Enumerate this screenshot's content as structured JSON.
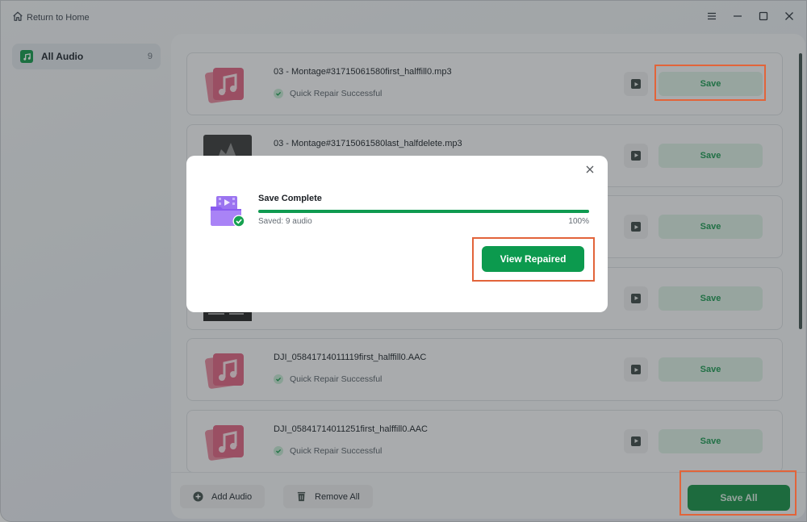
{
  "titlebar": {
    "return_label": "Return to Home",
    "controls": [
      "menu-icon",
      "minimize-icon",
      "maximize-icon",
      "close-icon"
    ]
  },
  "sidebar": {
    "items": [
      {
        "label": "All Audio",
        "count": "9",
        "icon": "music-note-icon"
      }
    ]
  },
  "files": [
    {
      "name": "03 - Montage#31715061580first_halffill0.mp3",
      "status": "Quick Repair Successful",
      "thumb": "audio",
      "save_label": "Save"
    },
    {
      "name": "03 - Montage#31715061580last_halfdelete.mp3",
      "status": "",
      "thumb": "photo",
      "save_label": "Save"
    },
    {
      "name": "",
      "status": "",
      "thumb": "photo",
      "save_label": "Save"
    },
    {
      "name": "",
      "status": "",
      "thumb": "photo",
      "save_label": "Save"
    },
    {
      "name": "DJI_05841714011119first_halffill0.AAC",
      "status": "Quick Repair Successful",
      "thumb": "audio",
      "save_label": "Save"
    },
    {
      "name": "DJI_05841714011251first_halffill0.AAC",
      "status": "Quick Repair Successful",
      "thumb": "audio",
      "save_label": "Save"
    }
  ],
  "footer": {
    "add_label": "Add Audio",
    "remove_label": "Remove All",
    "save_all_label": "Save All"
  },
  "modal": {
    "title": "Save Complete",
    "saved_text": "Saved: 9 audio",
    "progress_percent": 100,
    "progress_label": "100%",
    "button_label": "View Repaired"
  },
  "colors": {
    "accent": "#0c9a4e",
    "highlight": "#e2643a"
  }
}
